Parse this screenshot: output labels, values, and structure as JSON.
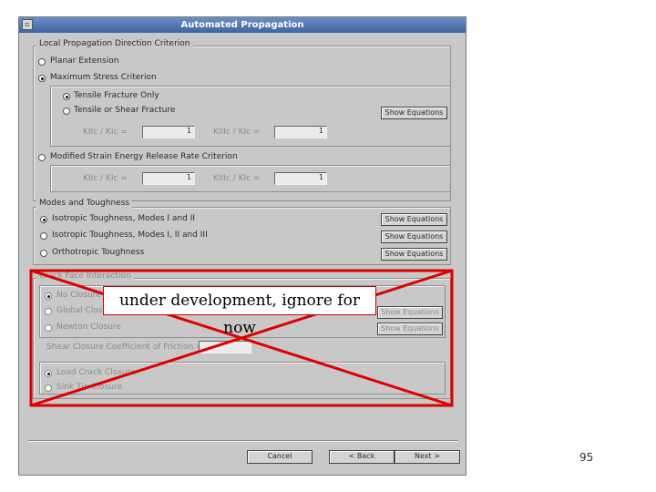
{
  "window": {
    "title": "Automated Propagation",
    "icon": "window-menu-icon"
  },
  "local_propagation": {
    "legend": "Local Propagation Direction Criterion",
    "options": [
      "Planar Extension",
      "Maximum Stress Criterion",
      "Modified Strain Energy Release Rate Criterion"
    ],
    "selected": "Maximum Stress Criterion",
    "max_stress": {
      "options": [
        "Tensile Fracture Only",
        "Tensile or Shear Fracture"
      ],
      "selected": "Tensile Fracture Only",
      "kii_label": "KIIc / KIc =",
      "kii_value": "1",
      "kiii_label": "KIIIc / KIc =",
      "kiii_value": "1",
      "show_equations": "Show Equations"
    },
    "strain_energy": {
      "kii_label": "KIIc / KIc =",
      "kii_value": "1",
      "kiii_label": "KIIIc / KIc =",
      "kiii_value": "1"
    }
  },
  "modes_toughness": {
    "legend": "Modes and Toughness",
    "options": [
      "Isotropic Toughness, Modes I and II",
      "Isotropic Toughness, Modes I, II and III",
      "Orthotropic Toughness"
    ],
    "selected": "Isotropic Toughness, Modes I and II",
    "show_equations": "Show Equations"
  },
  "crack_face": {
    "legend": "Crack Face Interaction",
    "options": [
      "No Closure",
      "Global Closure",
      "Newton Closure"
    ],
    "selected": "No Closure",
    "show_equations": "Show Equations",
    "friction_label": "Shear Closure Coefficient of Friction =",
    "friction_value": "",
    "closure_options": [
      "Load Crack Closure",
      "Sink Tip Closure"
    ],
    "closure_selected": "Load Crack Closure"
  },
  "overlay_note": "under development, ignore for now",
  "buttons": {
    "cancel": "Cancel",
    "back": "< Back",
    "next": "Next >"
  },
  "slide_number": "95",
  "colors": {
    "title_bar": "#4a6eb0",
    "cross_out": "#dd0000",
    "dialog_bg": "#c8c8c8"
  }
}
